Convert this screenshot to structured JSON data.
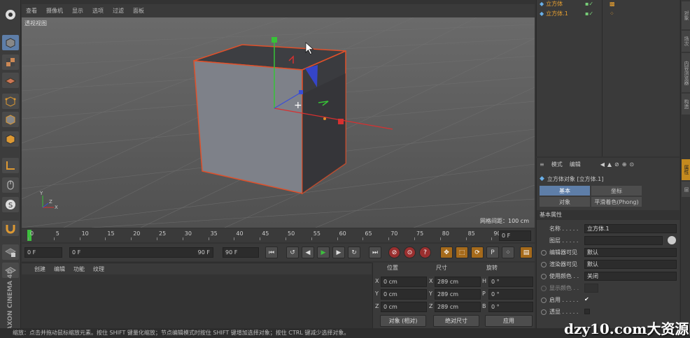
{
  "viewport": {
    "menu": [
      "查看",
      "摄像机",
      "显示",
      "选项",
      "过滤",
      "面板"
    ],
    "label": "透视视图",
    "grid_info": "网格间距：100 cm",
    "nav_icons": "✥⬍⟲▣"
  },
  "timeline": {
    "ticks": [
      "0",
      "5",
      "10",
      "15",
      "20",
      "25",
      "30",
      "35",
      "40",
      "45",
      "50",
      "55",
      "60",
      "65",
      "70",
      "75",
      "80",
      "85",
      "90"
    ],
    "end_frame": "0 F"
  },
  "transport": {
    "start": "0 F",
    "range_start": "0 F",
    "range_end": "90 F",
    "max": "90 F"
  },
  "material_menu": [
    "创建",
    "编辑",
    "功能",
    "纹理"
  ],
  "coords": {
    "headers": [
      "位置",
      "尺寸",
      "旋转"
    ],
    "rows": [
      {
        "axis": "X",
        "pos": "0 cm",
        "size_axis": "X",
        "size": "289 cm",
        "rot_axis": "H",
        "rot": "0 °"
      },
      {
        "axis": "Y",
        "pos": "0 cm",
        "size_axis": "Y",
        "size": "289 cm",
        "rot_axis": "P",
        "rot": "0 °"
      },
      {
        "axis": "Z",
        "pos": "0 cm",
        "size_axis": "Z",
        "size": "289 cm",
        "rot_axis": "B",
        "rot": "0 °"
      }
    ],
    "mode_select": "对象 (相对)",
    "size_select": "绝对尺寸",
    "apply": "应用"
  },
  "objects": {
    "items": [
      "立方体",
      "立方体.1"
    ]
  },
  "right_tabs": [
    "对象",
    "场次",
    "内容浏览器",
    "构造",
    "属性",
    "层"
  ],
  "attributes": {
    "menu": [
      "模式",
      "编辑"
    ],
    "title": "立方体对象 [立方体.1]",
    "tabs": [
      "基本",
      "坐标",
      "对象",
      "平滑着色(Phong)"
    ],
    "section": "基本属性",
    "rows": [
      {
        "label": "名称 . . . . .",
        "value": "立方体.1"
      },
      {
        "label": "图层 . . . . .",
        "value": ""
      },
      {
        "label": "编辑器可见",
        "value": "默认"
      },
      {
        "label": "渲染器可见",
        "value": "默认"
      },
      {
        "label": "使用颜色 . .",
        "value": "关闭"
      },
      {
        "label": "显示颜色 . .",
        "value": ""
      },
      {
        "label": "启用 . . . . .",
        "value": "✔"
      },
      {
        "label": "透显 . . . . .",
        "value": ""
      }
    ]
  },
  "status": "缩放：点击并拖动鼠标缩放元素。按住 SHIFT 键量化缩放；节点编辑模式时按住 SHIFT 键增加选择对象；按住 CTRL 键减少选择对象。",
  "brand": "MAXON CINEMA 4D",
  "watermark": "dzy10.com大资源网",
  "colors": {
    "accent": "#e0502a",
    "selection": "#5e7ea8",
    "play": "#3dbf3d"
  }
}
